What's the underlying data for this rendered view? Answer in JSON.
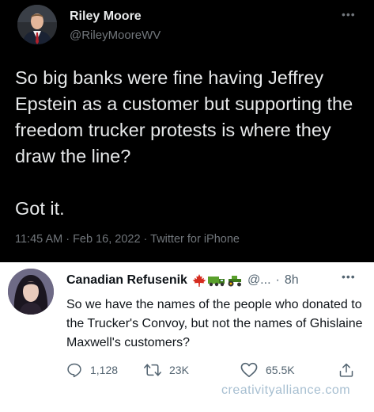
{
  "dark_tweet": {
    "name": "Riley Moore",
    "handle": "@RileyMooreWV",
    "more_icon": "more-horizontal-icon",
    "paragraphs": [
      "So big banks were fine having Jeffrey Epstein as a customer but supporting the freedom trucker protests is where they draw the line?",
      "Got it."
    ],
    "meta": "11:45 AM · Feb 16, 2022 · Twitter for iPhone"
  },
  "reply": {
    "name": "Canadian Refusenik",
    "emoji_icons": [
      "maple-leaf-icon",
      "truck-icon",
      "tractor-icon"
    ],
    "handle": "@...",
    "separator": "·",
    "time": "8h",
    "more_icon": "more-horizontal-icon",
    "text": "So we have the names of the people who donated to the Trucker's Convoy, but not the names of Ghislaine Maxwell's customers?",
    "actions": {
      "reply_count": "1,128",
      "retweet_count": "23K",
      "like_count": "65.5K"
    }
  },
  "watermark": "creativityalliance.com",
  "colors": {
    "dark_bg": "#000000",
    "dark_text": "#e7e9ea",
    "dark_secondary": "#71767b",
    "light_text": "#0f1419",
    "light_secondary": "#536471",
    "maple_red": "#d52b1e",
    "truck_green": "#5aa02c",
    "watermark": "#a7bfd1"
  }
}
